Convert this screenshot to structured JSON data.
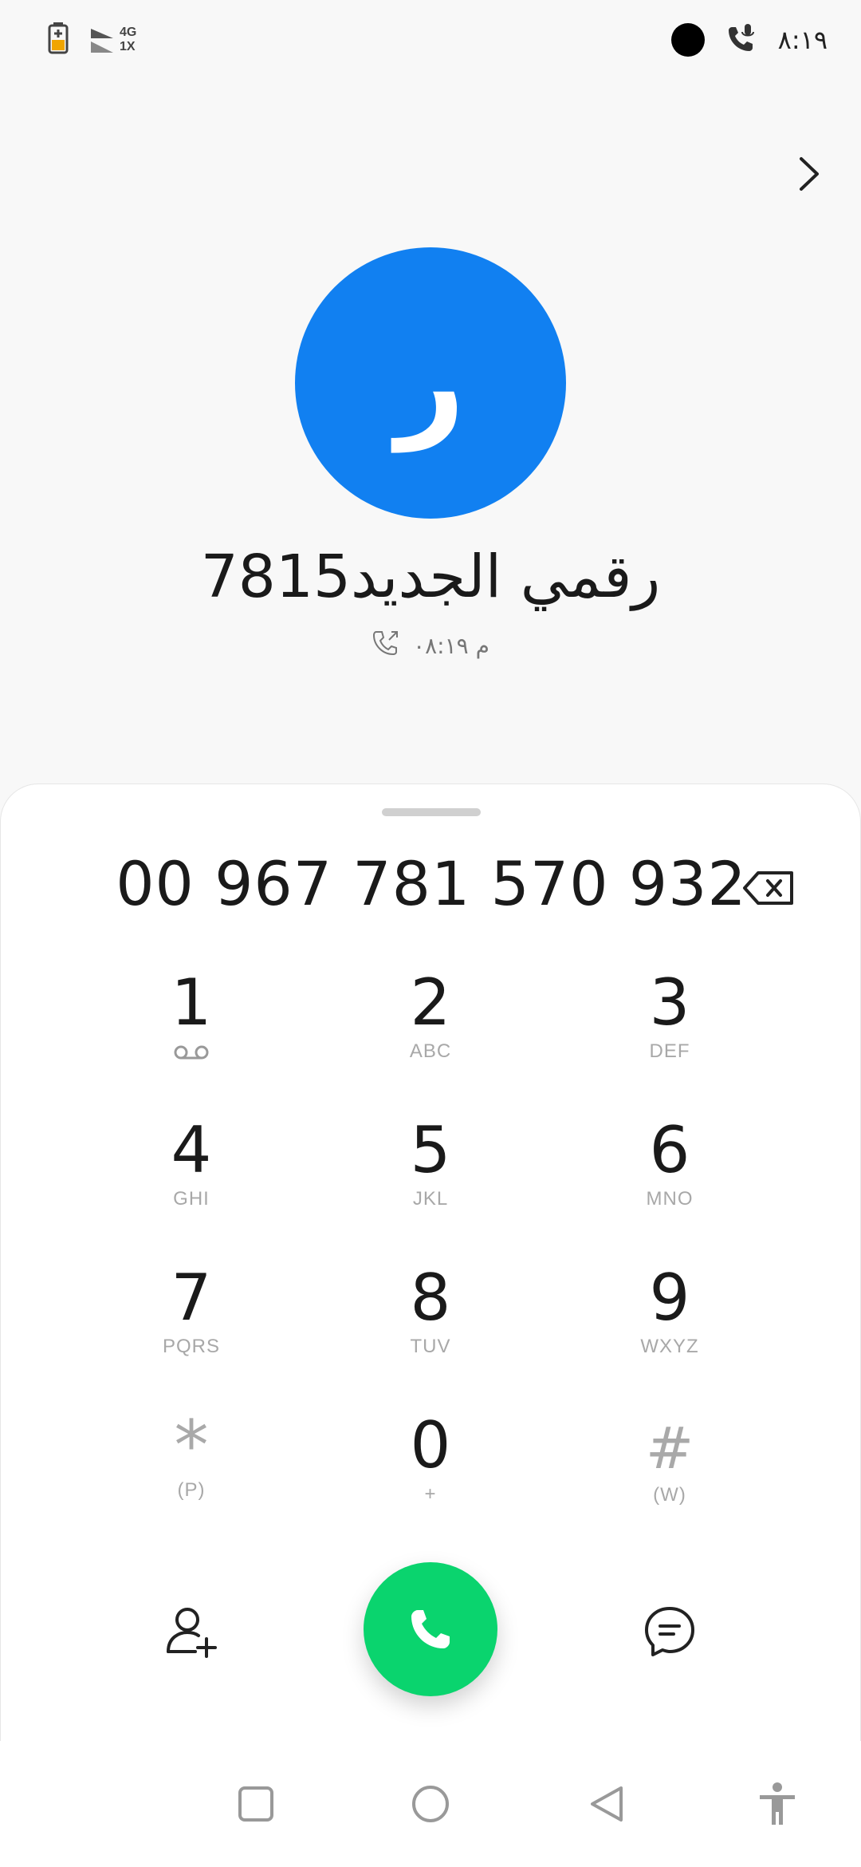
{
  "status_bar": {
    "time": "٨:١٩",
    "network_top": "4G",
    "network_bottom": "1X"
  },
  "contact": {
    "avatar_letter": "ر",
    "name": "رقمي الجديد7815",
    "call_time": "م ٠٨:١٩"
  },
  "dialer": {
    "number": "00 967 781 570 932",
    "keys": [
      {
        "digit": "1",
        "letters": ""
      },
      {
        "digit": "2",
        "letters": "ABC"
      },
      {
        "digit": "3",
        "letters": "DEF"
      },
      {
        "digit": "4",
        "letters": "GHI"
      },
      {
        "digit": "5",
        "letters": "JKL"
      },
      {
        "digit": "6",
        "letters": "MNO"
      },
      {
        "digit": "7",
        "letters": "PQRS"
      },
      {
        "digit": "8",
        "letters": "TUV"
      },
      {
        "digit": "9",
        "letters": "WXYZ"
      },
      {
        "digit": "*",
        "letters": "(P)"
      },
      {
        "digit": "0",
        "letters": "+"
      },
      {
        "digit": "#",
        "letters": "(W)"
      }
    ]
  },
  "colors": {
    "avatar": "#1180f1",
    "call_button": "#0ad46e"
  },
  "icons": {
    "chevron": "chevron-right-icon",
    "backspace": "backspace-icon",
    "voicemail": "voicemail-icon",
    "add_contact": "add-contact-icon",
    "call": "phone-icon",
    "message": "message-icon",
    "nav_recents": "square-icon",
    "nav_home": "circle-icon",
    "nav_back": "triangle-back-icon",
    "accessibility": "accessibility-icon"
  }
}
